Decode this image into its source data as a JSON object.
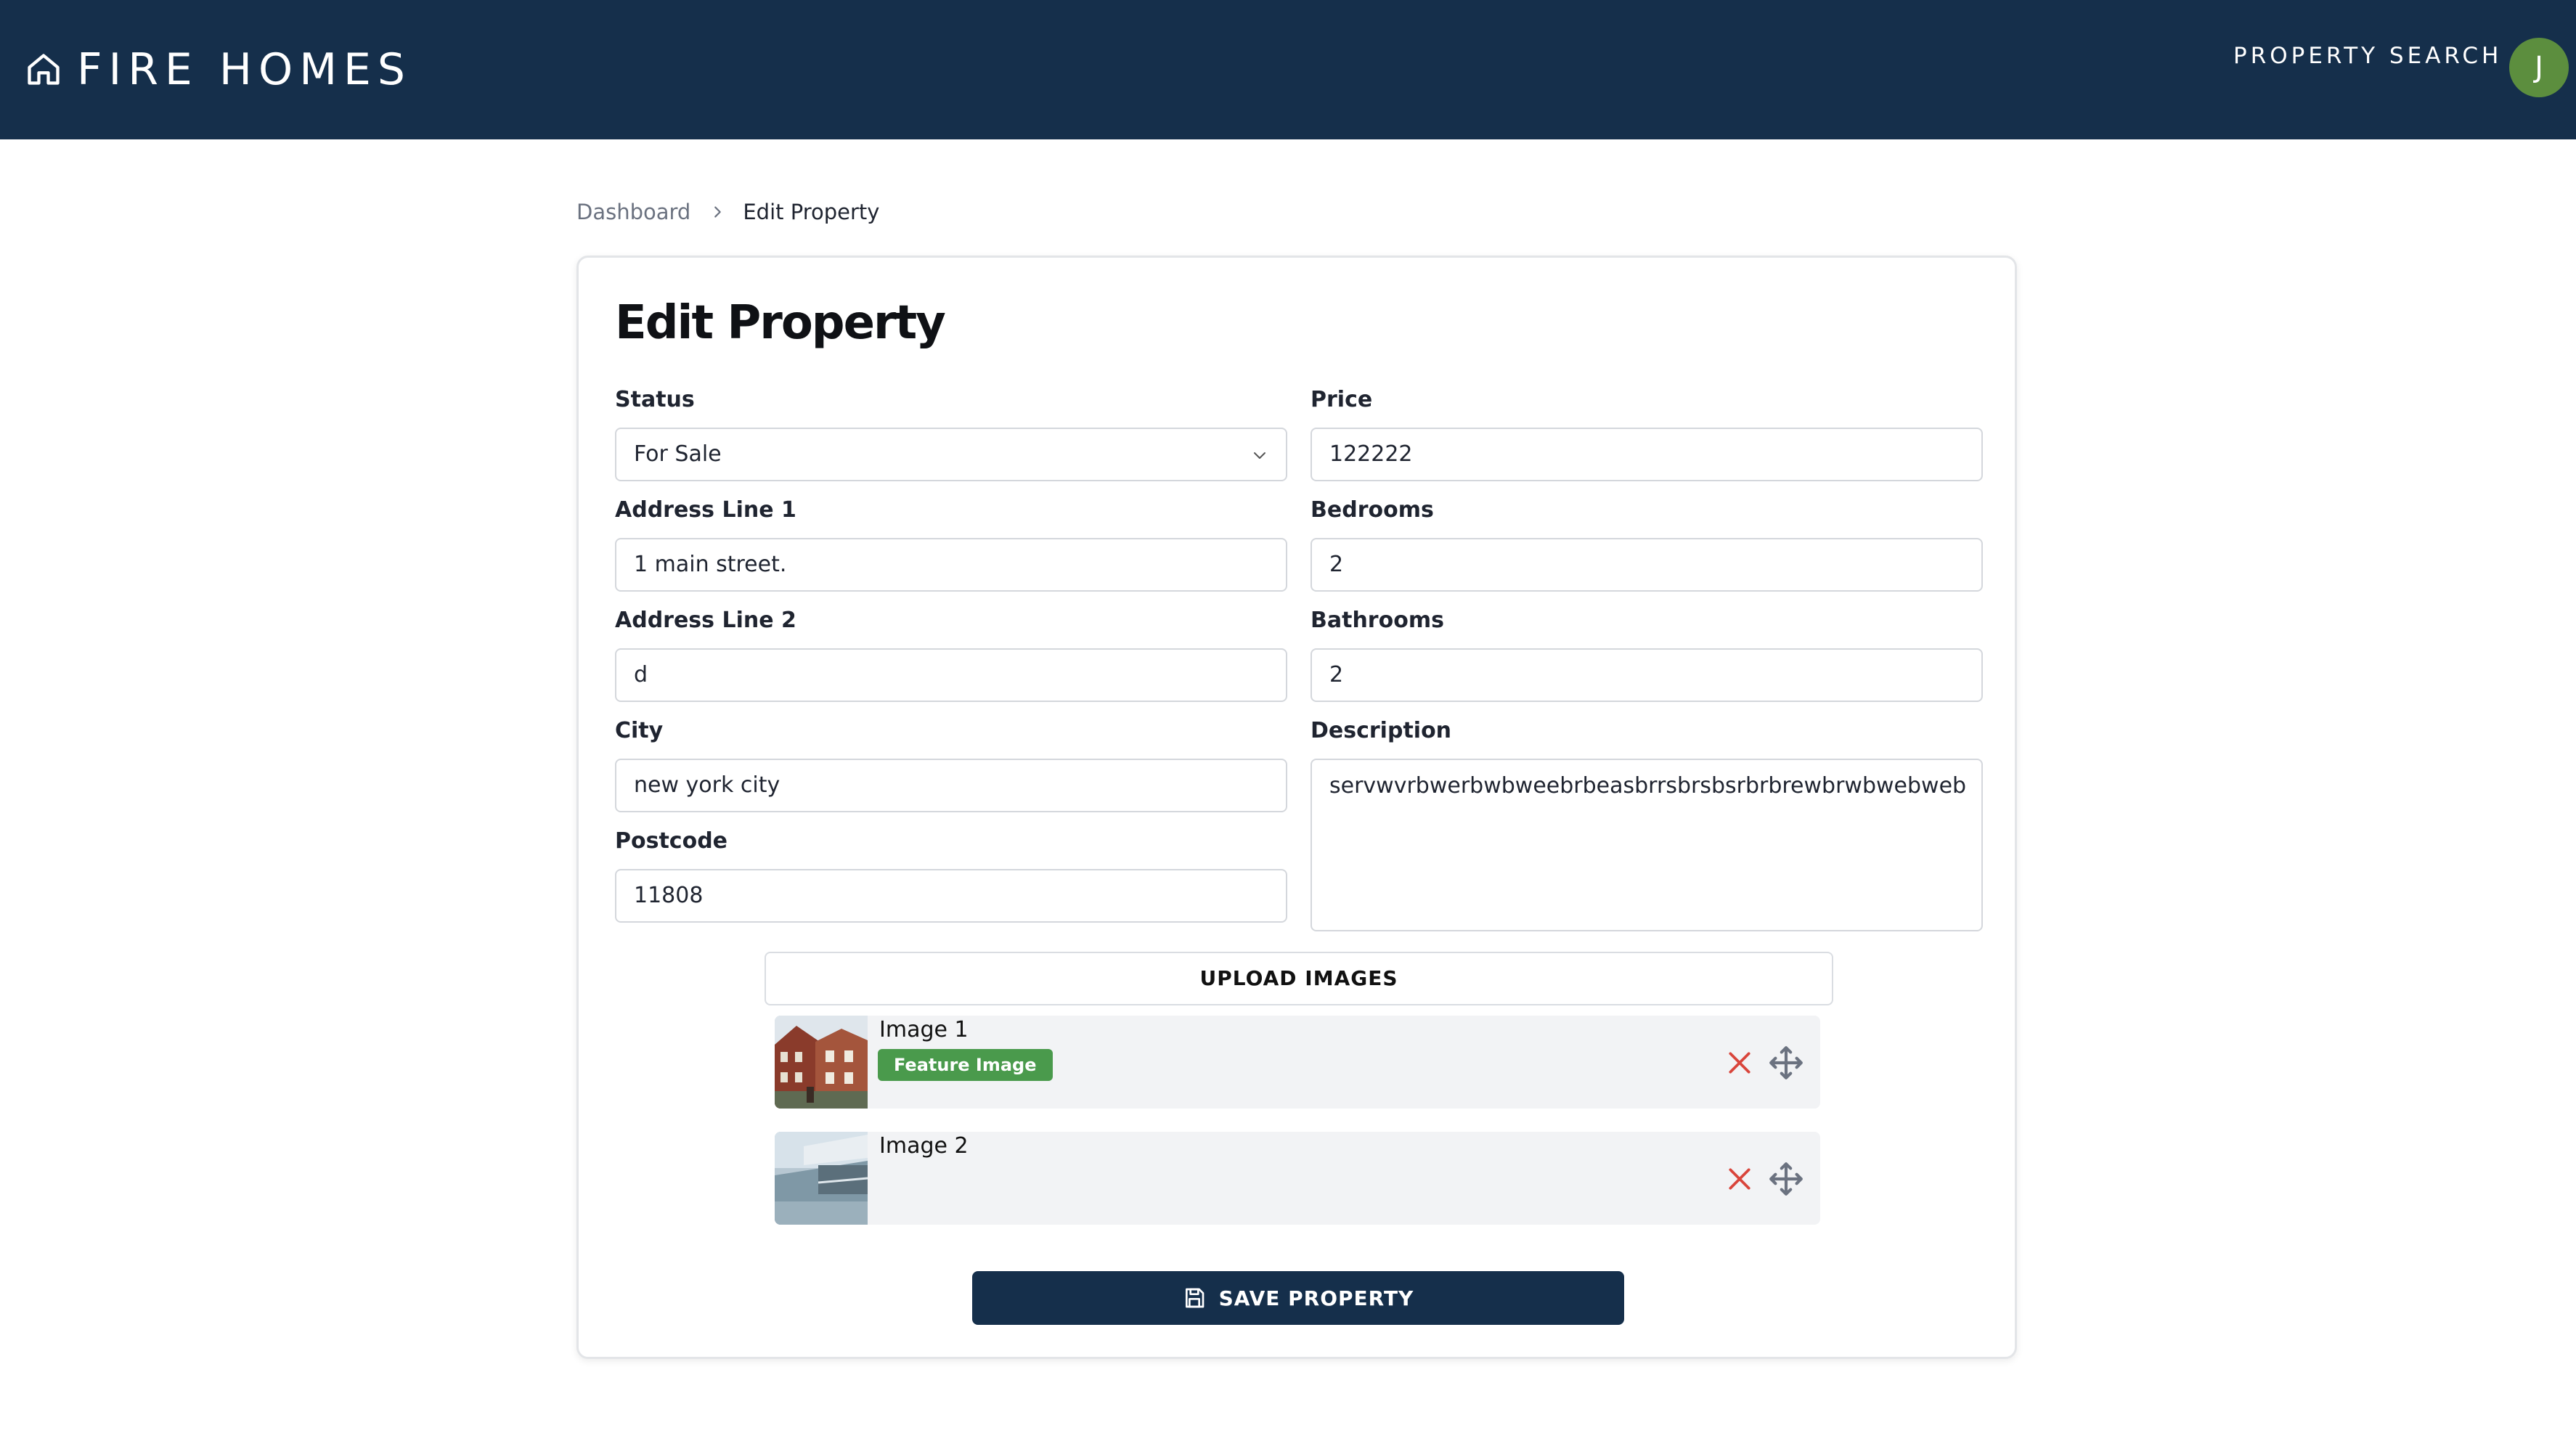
{
  "header": {
    "brand": "FIRE HOMES",
    "nav_property_search": "PROPERTY SEARCH",
    "avatar_initial": "J",
    "bg_color": "#152f4b",
    "avatar_color": "#5c8e3e"
  },
  "breadcrumb": {
    "home": "Dashboard",
    "current": "Edit Property"
  },
  "form": {
    "title": "Edit Property",
    "status": {
      "label": "Status",
      "value": "For Sale"
    },
    "price": {
      "label": "Price",
      "value": "122222"
    },
    "address1": {
      "label": "Address Line 1",
      "value": "1 main street."
    },
    "bedrooms": {
      "label": "Bedrooms",
      "value": "2"
    },
    "address2": {
      "label": "Address Line 2",
      "value": "d"
    },
    "bathrooms": {
      "label": "Bathrooms",
      "value": "2"
    },
    "city": {
      "label": "City",
      "value": "new york city"
    },
    "description": {
      "label": "Description",
      "value": "servwvrbwerbwbweebrbeasbrrsbrsbsrbrbrewbrwbwebweb"
    },
    "postcode": {
      "label": "Postcode",
      "value": "11808"
    }
  },
  "images": {
    "upload_label": "UPLOAD IMAGES",
    "items": [
      {
        "label": "Image 1",
        "badge": "Feature Image"
      },
      {
        "label": "Image 2"
      }
    ]
  },
  "actions": {
    "save_label": "SAVE PROPERTY"
  },
  "icons": {
    "brand": "home-icon",
    "breadcrumb_separator": "chevron-right-icon",
    "select": "chevron-down-icon",
    "remove": "close-icon",
    "move": "move-icon",
    "save": "save-icon"
  }
}
